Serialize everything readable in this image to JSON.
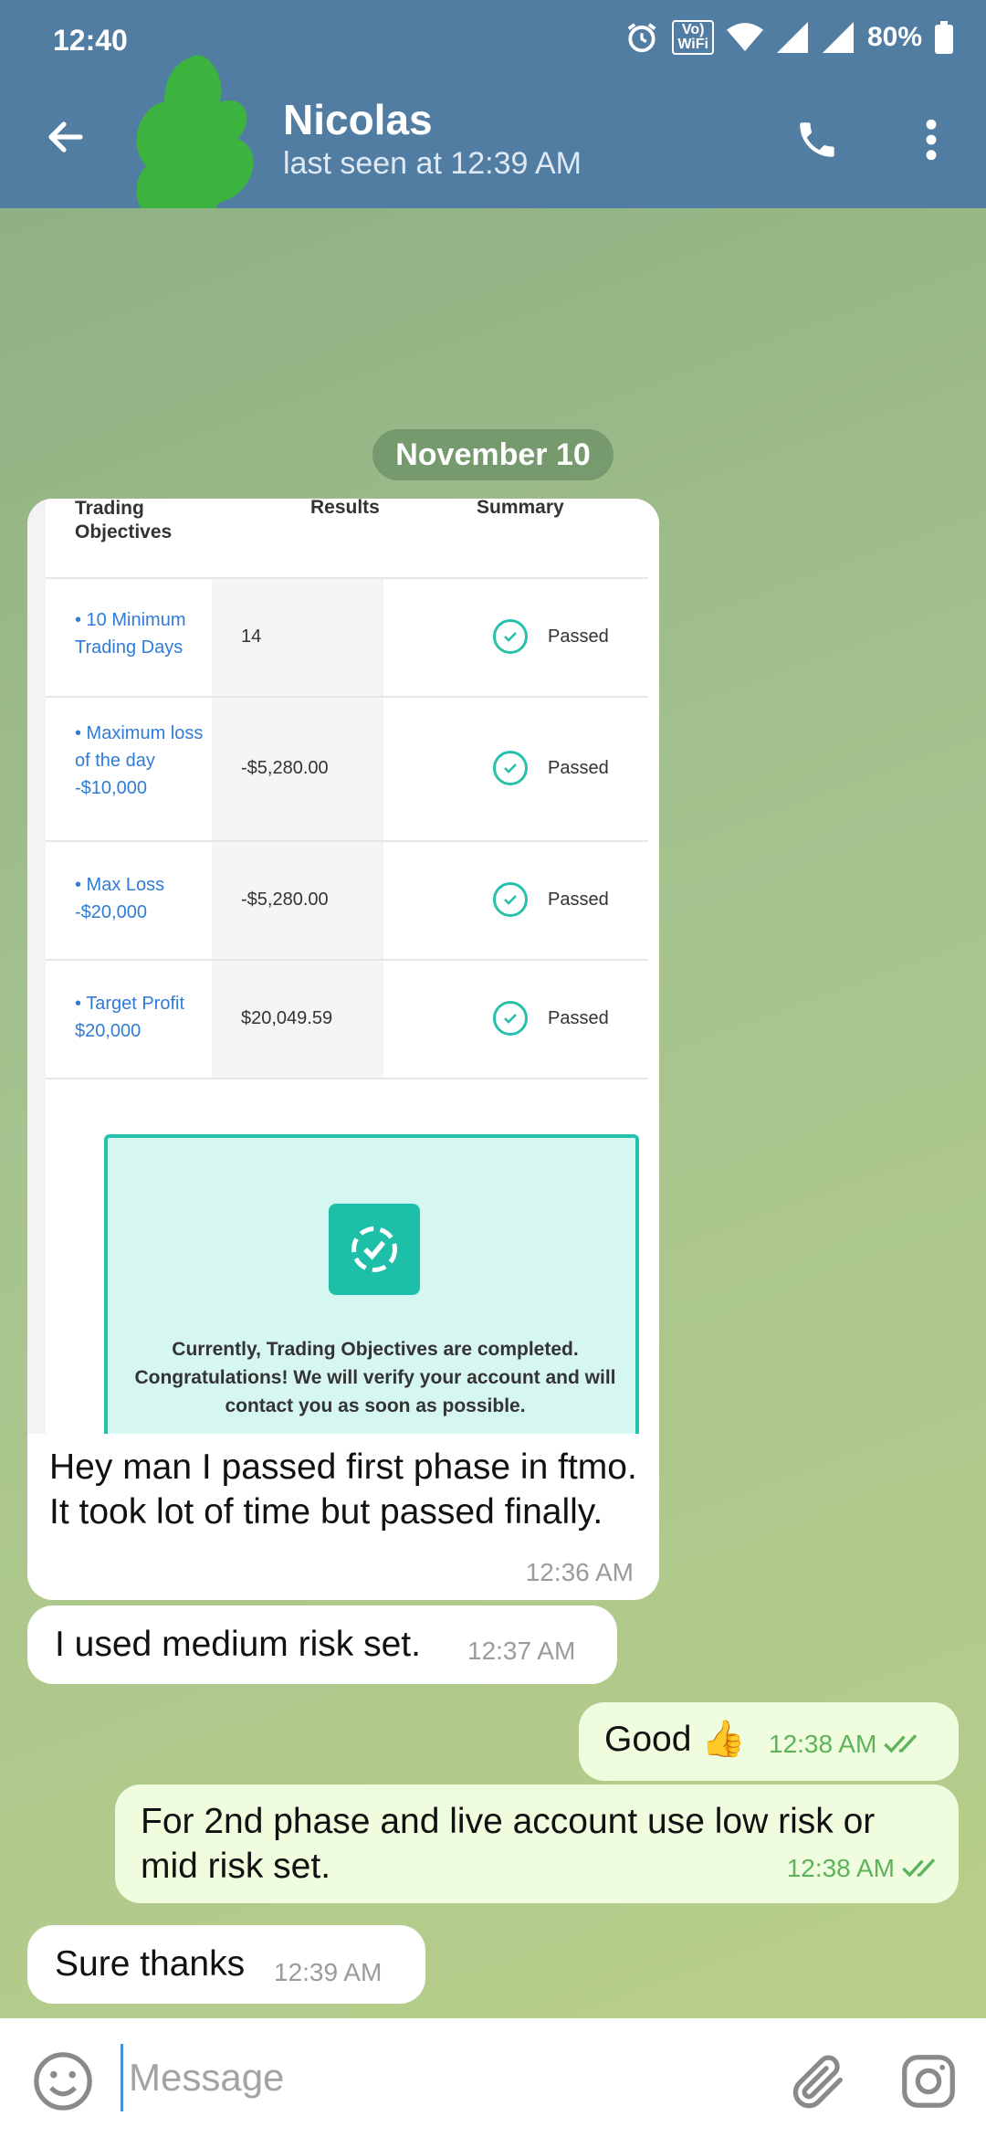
{
  "status_bar": {
    "time": "12:40",
    "vowifi_top": "Vo)",
    "vowifi_bottom": "WiFi",
    "battery": "80%"
  },
  "header": {
    "name": "Nicolas",
    "last_seen": "last seen at 12:39 AM"
  },
  "date_separator": "November 10",
  "photo": {
    "headers": [
      "Trading Objectives",
      "Results",
      "Summary"
    ],
    "rows": [
      {
        "objective": "• 10 Minimum Trading Days",
        "result": "14",
        "summary": "Passed"
      },
      {
        "objective": "• Maximum loss of the day -$10,000",
        "result": "-$5,280.00",
        "summary": "Passed"
      },
      {
        "objective": "• Max Loss -$20,000",
        "result": "-$5,280.00",
        "summary": "Passed"
      },
      {
        "objective": "• Target Profit $20,000",
        "result": "$20,049.59",
        "summary": "Passed"
      }
    ],
    "box_text": "Currently, Trading Objectives are completed. Congratulations! We will verify your account and will contact you as soon as possible."
  },
  "messages": [
    {
      "text": "Hey man I passed first phase in ftmo. It took lot of time but passed finally.",
      "time": "12:36 AM"
    },
    {
      "text": "I used medium risk set.",
      "time": "12:37 AM"
    },
    {
      "text": "Good 👍",
      "time": "12:38 AM"
    },
    {
      "text": "For 2nd phase and live account use low risk or mid risk set.",
      "time": "12:38 AM"
    },
    {
      "text": "Sure thanks",
      "time": "12:39 AM"
    }
  ],
  "input": {
    "placeholder": "Message"
  },
  "colors": {
    "header": "#527da3",
    "outgoing_bubble": "#effdde",
    "incoming_bubble": "#ffffff",
    "read_check": "#5db35a",
    "accent_teal": "#25c2ab"
  }
}
